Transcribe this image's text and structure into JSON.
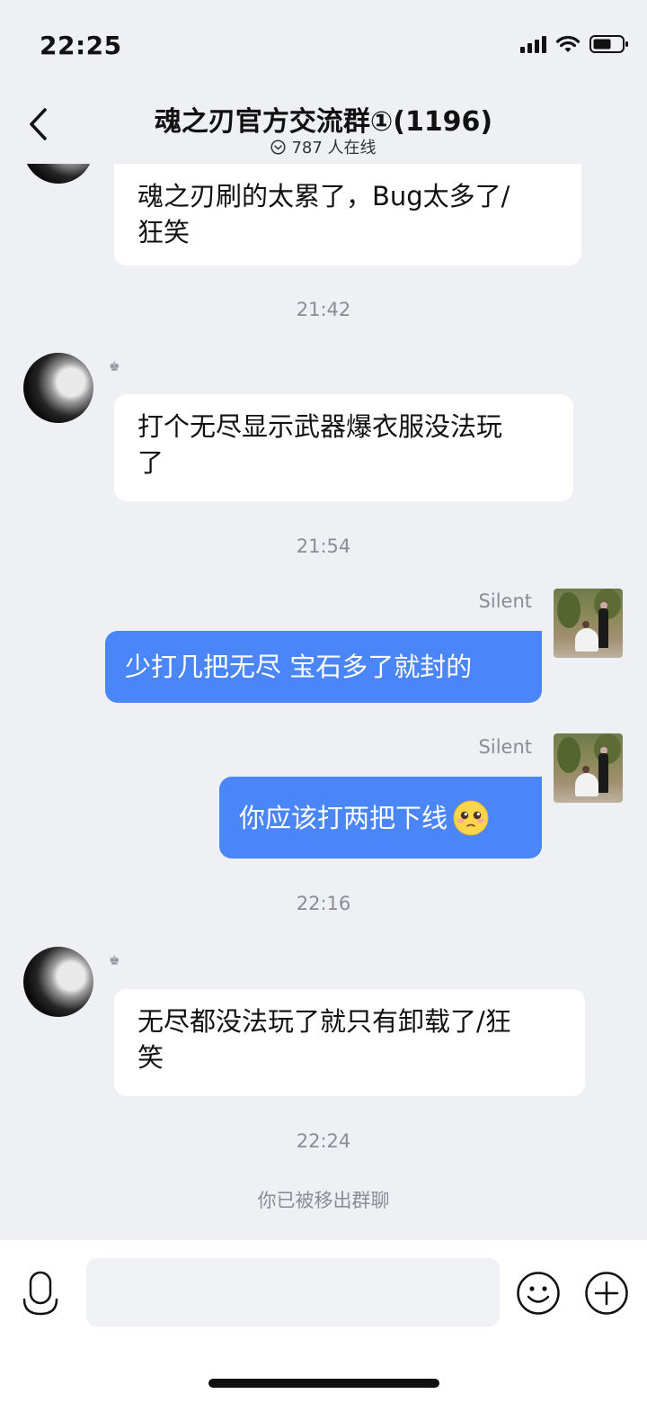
{
  "status_bar": {
    "time": "22:25"
  },
  "header": {
    "title": "魂之刃官方交流群①(1196)",
    "online_count": "787 人在线"
  },
  "messages": [
    {
      "type": "incoming",
      "text_line1": "魂之刃刷的太累了，Bug太多了/",
      "text_line2": "狂笑"
    },
    {
      "type": "time",
      "text": "21:42"
    },
    {
      "type": "incoming",
      "badge": "♚",
      "text_line1": "打个无尽显示武器爆衣服没法玩",
      "text_line2": "了"
    },
    {
      "type": "time",
      "text": "21:54"
    },
    {
      "type": "outgoing",
      "sender": "Silent",
      "text": "少打几把无尽 宝石多了就封的"
    },
    {
      "type": "outgoing",
      "sender": "Silent",
      "text": "你应该打两把下线",
      "emoji": "pleading-face"
    },
    {
      "type": "time",
      "text": "22:16"
    },
    {
      "type": "incoming",
      "badge": "♚",
      "text_line1": "无尽都没法玩了就只有卸载了/狂",
      "text_line2": "笑"
    },
    {
      "type": "time",
      "text": "22:24"
    },
    {
      "type": "system",
      "text": "你已被移出群聊"
    }
  ],
  "input_bar": {
    "placeholder": ""
  },
  "colors": {
    "background": "#eff0f4",
    "outgoing_bubble": "#4a86f7",
    "incoming_bubble": "#ffffff",
    "meta_text": "#8a8d94"
  },
  "icons": {
    "back": "chevron-left-icon",
    "online": "chevron-down-circle-icon",
    "voice": "microphone-icon",
    "emoji": "smiley-icon",
    "plus": "plus-circle-icon"
  }
}
